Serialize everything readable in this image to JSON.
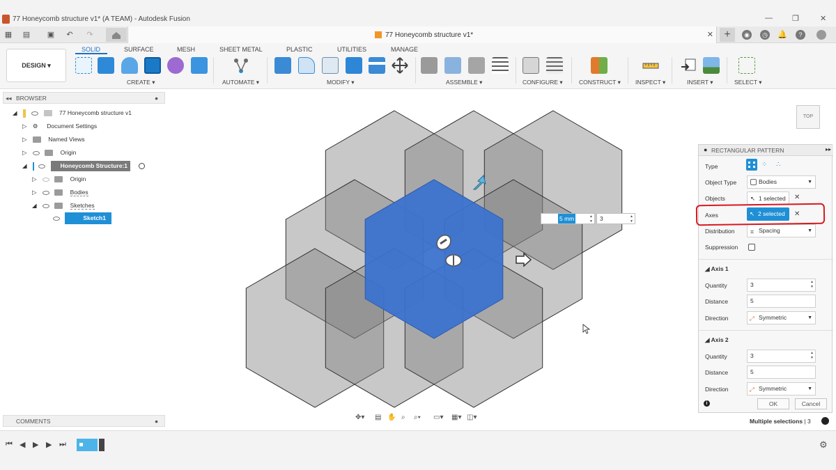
{
  "window": {
    "title": "77 Honeycomb structure v1* (A TEAM) - Autodesk Fusion",
    "minimize": "—",
    "maximize": "❐",
    "close": "✕"
  },
  "document": {
    "tab_title": "77 Honeycomb structure v1*",
    "close": "✕"
  },
  "ribbon": {
    "workspace": "DESIGN ▾",
    "tabs": [
      "SOLID",
      "SURFACE",
      "MESH",
      "SHEET METAL",
      "PLASTIC",
      "UTILITIES",
      "MANAGE"
    ],
    "groups": [
      "CREATE ▾",
      "AUTOMATE ▾",
      "MODIFY ▾",
      "ASSEMBLE ▾",
      "CONFIGURE ▾",
      "CONSTRUCT ▾",
      "INSPECT ▾",
      "INSERT ▾",
      "SELECT ▾"
    ]
  },
  "browser": {
    "title": "BROWSER",
    "items": [
      {
        "label": "77 Honeycomb structure v1"
      },
      {
        "label": "Document Settings"
      },
      {
        "label": "Named Views"
      },
      {
        "label": "Origin"
      },
      {
        "label": "Honeycomb Structure:1"
      },
      {
        "label": "Origin"
      },
      {
        "label": "Bodies"
      },
      {
        "label": "Sketches"
      },
      {
        "label": "Sketch1"
      }
    ]
  },
  "comments": {
    "title": "COMMENTS"
  },
  "viewcube": {
    "label": "TOP"
  },
  "canvas_input": {
    "distance": "5 mm",
    "quantity": "3"
  },
  "panel": {
    "title": "RECTANGULAR PATTERN",
    "type_label": "Type",
    "object_type_label": "Object Type",
    "object_type_value": "Bodies",
    "objects_label": "Objects",
    "objects_value": "1 selected",
    "axes_label": "Axes",
    "axes_value": "2 selected",
    "distribution_label": "Distribution",
    "distribution_value": "Spacing",
    "suppression_label": "Suppression",
    "axis1": {
      "title": "Axis 1",
      "quantity_label": "Quantity",
      "quantity": "3",
      "distance_label": "Distance",
      "distance": "5",
      "direction_label": "Direction",
      "direction": "Symmetric"
    },
    "axis2": {
      "title": "Axis 2",
      "quantity_label": "Quantity",
      "quantity": "3",
      "distance_label": "Distance",
      "distance": "5",
      "direction_label": "Direction",
      "direction": "Symmetric"
    },
    "ok": "OK",
    "cancel": "Cancel"
  },
  "status": {
    "label": "Multiple selections",
    "count": " | 3"
  },
  "colors": {
    "accent": "#1f8fd6",
    "selected_body": "#3b73d1",
    "highlight": "#d8181f"
  }
}
